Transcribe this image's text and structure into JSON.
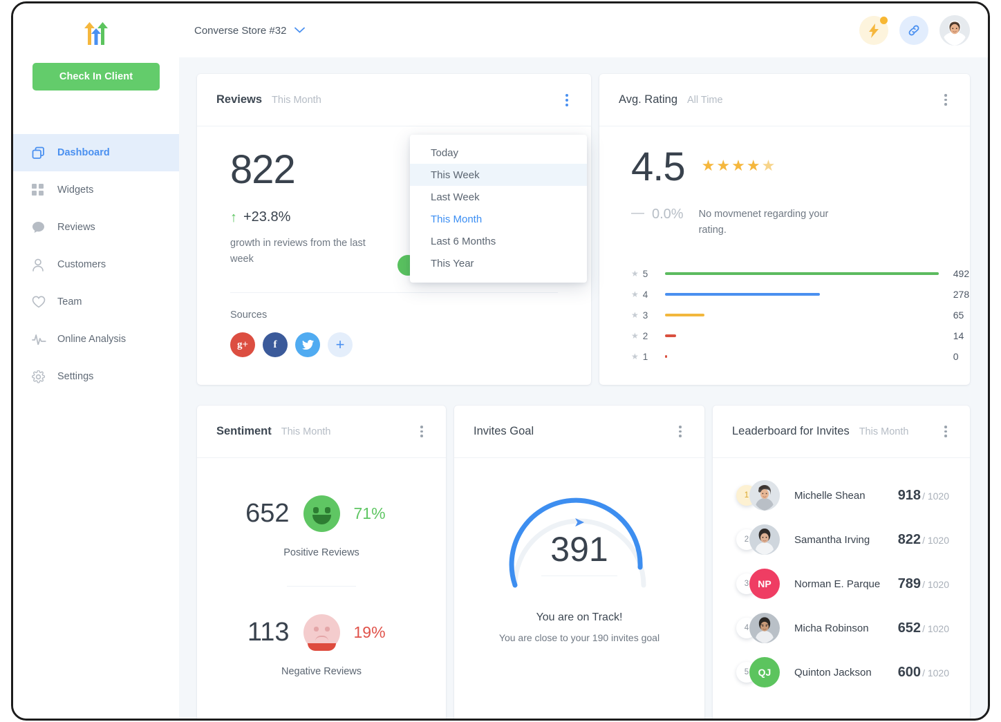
{
  "sidebar": {
    "logo_icon": "three-arrows-logo",
    "checkin_label": "Check In Client",
    "items": [
      {
        "label": "Dashboard",
        "icon": "dashboard-icon",
        "active": true
      },
      {
        "label": "Widgets",
        "icon": "widgets-icon",
        "active": false
      },
      {
        "label": "Reviews",
        "icon": "chat-bubble-icon",
        "active": false
      },
      {
        "label": "Customers",
        "icon": "user-icon",
        "active": false
      },
      {
        "label": "Team",
        "icon": "heart-icon",
        "active": false
      },
      {
        "label": "Online Analysis",
        "icon": "pulse-icon",
        "active": false
      },
      {
        "label": "Settings",
        "icon": "gear-icon",
        "active": false
      }
    ]
  },
  "topbar": {
    "store_name": "Converse Store #32",
    "chevron_icon": "chevron-down-icon",
    "bolt_icon": "lightning-bolt-icon",
    "link_icon": "link-icon",
    "avatar_icon": "user-avatar"
  },
  "reviews_card": {
    "title": "Reviews",
    "period": "This Month",
    "value": "822",
    "delta": "+23.8%",
    "delta_icon": "arrow-up-icon",
    "delta_desc": "growth in reviews from the last week",
    "sources_label": "Sources",
    "sources": [
      {
        "name": "google-plus",
        "glyph": "g+"
      },
      {
        "name": "facebook",
        "glyph": "f"
      },
      {
        "name": "twitter",
        "glyph": "ᵗ"
      },
      {
        "name": "add-source",
        "glyph": "+"
      }
    ]
  },
  "dropdown": {
    "items": [
      {
        "label": "Today",
        "state": "normal"
      },
      {
        "label": "This Week",
        "state": "hover"
      },
      {
        "label": "Last Week",
        "state": "normal"
      },
      {
        "label": "This Month",
        "state": "active"
      },
      {
        "label": "Last 6 Months",
        "state": "normal"
      },
      {
        "label": "This Year",
        "state": "normal"
      }
    ]
  },
  "rating_card": {
    "title": "Avg. Rating",
    "period": "All Time",
    "value": "4.5",
    "stars_full": 4,
    "stars_half": 1,
    "delta": "0.0%",
    "delta_icon": "dash-icon",
    "delta_desc": "No movmenet regarding your rating."
  },
  "chart_data": {
    "type": "bar",
    "title": "Rating distribution",
    "orientation": "horizontal",
    "categories": [
      "5",
      "4",
      "3",
      "2",
      "1"
    ],
    "values": [
      492,
      278,
      65,
      14,
      0
    ],
    "labels": [
      "492",
      "278",
      "65",
      "14",
      "0"
    ],
    "colors": [
      "#5cbb5f",
      "#4a90f0",
      "#f2b73d",
      "#d9503f",
      "#d9503f"
    ],
    "max": 492,
    "xlabel": "",
    "ylabel": "Stars",
    "grid": false,
    "legend": "none"
  },
  "sentiment_card": {
    "title": "Sentiment",
    "period": "This Month",
    "positive": {
      "count": "652",
      "pct": "71%",
      "caption": "Positive Reviews",
      "icon": "smiling-face-icon"
    },
    "negative": {
      "count": "113",
      "pct": "19%",
      "caption": "Negative Reviews",
      "icon": "sad-face-icon"
    }
  },
  "invites_card": {
    "title": "Invites Goal",
    "value": "391",
    "arrow_icon": "send-arrow-icon",
    "status": "You are on Track!",
    "hint": "You are close to your 190 invites goal",
    "progress_pct": 86
  },
  "leaderboard_card": {
    "title": "Leaderboard for Invites",
    "period": "This Month",
    "goal": "1020",
    "rows": [
      {
        "rank": "1",
        "name": "Michelle Shean",
        "score": "918",
        "total": "/ 1020",
        "avatar": "photo",
        "initials": ""
      },
      {
        "rank": "2",
        "name": "Samantha Irving",
        "score": "822",
        "total": "/ 1020",
        "avatar": "photo",
        "initials": ""
      },
      {
        "rank": "3",
        "name": "Norman E. Parque",
        "score": "789",
        "total": "/ 1020",
        "avatar": "initials-pink",
        "initials": "NP"
      },
      {
        "rank": "4",
        "name": "Micha Robinson",
        "score": "652",
        "total": "/ 1020",
        "avatar": "photo",
        "initials": ""
      },
      {
        "rank": "5",
        "name": "Quinton Jackson",
        "score": "600",
        "total": "/ 1020",
        "avatar": "initials-green",
        "initials": "QJ"
      }
    ]
  },
  "colors": {
    "accent": "#4a90f0",
    "success": "#5cc45e",
    "warning": "#f2b73d",
    "danger": "#d9503f",
    "bg": "#f4f7fa"
  }
}
